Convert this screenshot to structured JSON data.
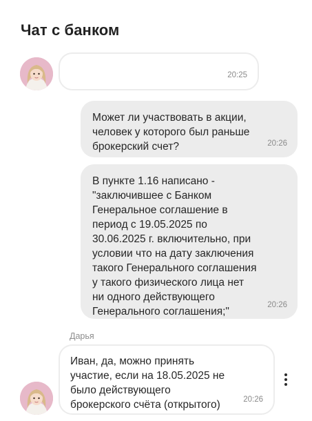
{
  "header": {
    "title": "Чат с банком"
  },
  "messages": [
    {
      "direction": "in",
      "text": "",
      "time": "20:25"
    },
    {
      "direction": "out",
      "text": "Может ли участвовать в акции,\nчеловек у которого был раньше\nброкерский счет?",
      "time": "20:26"
    },
    {
      "direction": "out",
      "text": "В пункте 1.16 написано -\n\"заключившее с Банком\nГенеральное соглашение в\nпериод с 19.05.2025 по\n30.06.2025 г. включительно, при\nусловии что на дату заключения\nтакого Генерального соглашения\nу такого физического лица нет\nни одного действующего\nГенерального соглашения;\"",
      "time": "20:26"
    },
    {
      "direction": "in",
      "sender": "Дарья",
      "text": "Иван, да, можно принять\nучастие, если на 18.05.2025 не\nбыло действующего\nброкерского счёта (открытого)",
      "time": "20:26"
    }
  ],
  "icons": {
    "menu": "more-vertical-icon",
    "avatar": "agent-avatar"
  },
  "colors": {
    "outgoing_bubble": "#ececec",
    "incoming_border": "#ececec",
    "avatar_bg": "#e7b9c9"
  }
}
